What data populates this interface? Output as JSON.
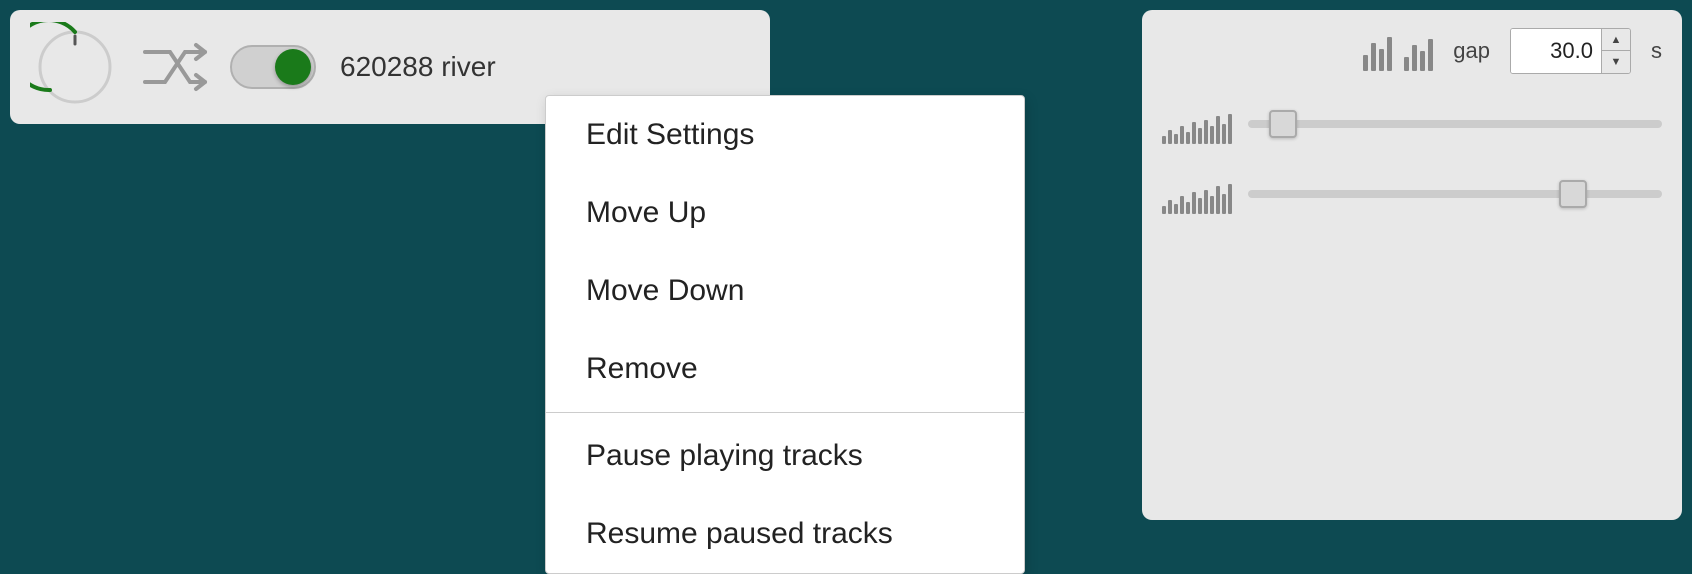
{
  "background": {
    "color": "#0d4a52"
  },
  "track_card": {
    "track_id": "620288",
    "track_name": "620288  river",
    "toggle_state": "on"
  },
  "context_menu": {
    "items": [
      {
        "id": "edit-settings",
        "label": "Edit Settings",
        "divider_after": false
      },
      {
        "id": "move-up",
        "label": "Move Up",
        "divider_after": false
      },
      {
        "id": "move-down",
        "label": "Move Down",
        "divider_after": false
      },
      {
        "id": "remove",
        "label": "Remove",
        "divider_after": true
      },
      {
        "id": "pause-playing",
        "label": "Pause playing tracks",
        "divider_after": false
      },
      {
        "id": "resume-paused",
        "label": "Resume paused tracks",
        "divider_after": false
      }
    ]
  },
  "right_panel": {
    "gap_label": "gap",
    "gap_value": "30.0",
    "gap_unit": "s"
  }
}
